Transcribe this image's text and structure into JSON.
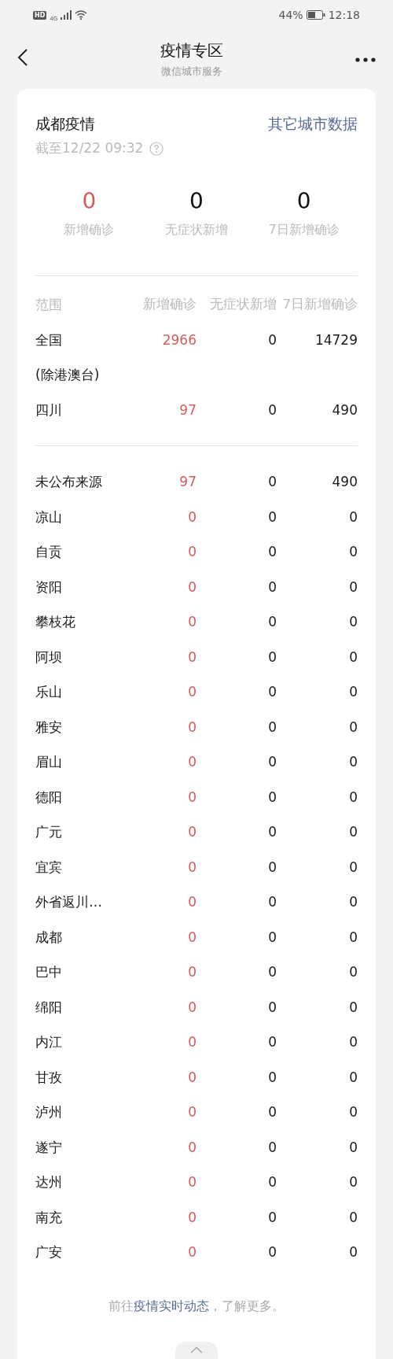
{
  "status_bar": {
    "hd": "HD",
    "network": "4G",
    "battery": "44%",
    "time": "12:18"
  },
  "header": {
    "title": "疫情专区",
    "subtitle": "微信城市服务"
  },
  "card": {
    "city_title": "成都疫情",
    "other_cities_link": "其它城市数据",
    "updated": "截至12/22 09:32",
    "stats": [
      {
        "value": "0",
        "label": "新增确诊",
        "highlight": true
      },
      {
        "value": "0",
        "label": "无症状新增",
        "highlight": false
      },
      {
        "value": "0",
        "label": "7日新增确诊",
        "highlight": false
      }
    ],
    "table": {
      "columns": [
        "范围",
        "新增确诊",
        "无症状新增",
        "7日新增确诊"
      ],
      "groups": [
        [
          {
            "name": "全国(除港澳台)",
            "new_confirmed": "2966",
            "asymptomatic": "0",
            "confirmed_7d": "14729"
          },
          {
            "name": "四川",
            "new_confirmed": "97",
            "asymptomatic": "0",
            "confirmed_7d": "490"
          }
        ],
        [
          {
            "name": "未公布来源",
            "new_confirmed": "97",
            "asymptomatic": "0",
            "confirmed_7d": "490"
          },
          {
            "name": "凉山",
            "new_confirmed": "0",
            "asymptomatic": "0",
            "confirmed_7d": "0"
          },
          {
            "name": "自贡",
            "new_confirmed": "0",
            "asymptomatic": "0",
            "confirmed_7d": "0"
          },
          {
            "name": "资阳",
            "new_confirmed": "0",
            "asymptomatic": "0",
            "confirmed_7d": "0"
          },
          {
            "name": "攀枝花",
            "new_confirmed": "0",
            "asymptomatic": "0",
            "confirmed_7d": "0"
          },
          {
            "name": "阿坝",
            "new_confirmed": "0",
            "asymptomatic": "0",
            "confirmed_7d": "0"
          },
          {
            "name": "乐山",
            "new_confirmed": "0",
            "asymptomatic": "0",
            "confirmed_7d": "0"
          },
          {
            "name": "雅安",
            "new_confirmed": "0",
            "asymptomatic": "0",
            "confirmed_7d": "0"
          },
          {
            "name": "眉山",
            "new_confirmed": "0",
            "asymptomatic": "0",
            "confirmed_7d": "0"
          },
          {
            "name": "德阳",
            "new_confirmed": "0",
            "asymptomatic": "0",
            "confirmed_7d": "0"
          },
          {
            "name": "广元",
            "new_confirmed": "0",
            "asymptomatic": "0",
            "confirmed_7d": "0"
          },
          {
            "name": "宜宾",
            "new_confirmed": "0",
            "asymptomatic": "0",
            "confirmed_7d": "0"
          },
          {
            "name": "外省返川…",
            "new_confirmed": "0",
            "asymptomatic": "0",
            "confirmed_7d": "0"
          },
          {
            "name": "成都",
            "new_confirmed": "0",
            "asymptomatic": "0",
            "confirmed_7d": "0"
          },
          {
            "name": "巴中",
            "new_confirmed": "0",
            "asymptomatic": "0",
            "confirmed_7d": "0"
          },
          {
            "name": "绵阳",
            "new_confirmed": "0",
            "asymptomatic": "0",
            "confirmed_7d": "0"
          },
          {
            "name": "内江",
            "new_confirmed": "0",
            "asymptomatic": "0",
            "confirmed_7d": "0"
          },
          {
            "name": "甘孜",
            "new_confirmed": "0",
            "asymptomatic": "0",
            "confirmed_7d": "0"
          },
          {
            "name": "泸州",
            "new_confirmed": "0",
            "asymptomatic": "0",
            "confirmed_7d": "0"
          },
          {
            "name": "遂宁",
            "new_confirmed": "0",
            "asymptomatic": "0",
            "confirmed_7d": "0"
          },
          {
            "name": "达州",
            "new_confirmed": "0",
            "asymptomatic": "0",
            "confirmed_7d": "0"
          },
          {
            "name": "南充",
            "new_confirmed": "0",
            "asymptomatic": "0",
            "confirmed_7d": "0"
          },
          {
            "name": "广安",
            "new_confirmed": "0",
            "asymptomatic": "0",
            "confirmed_7d": "0"
          }
        ]
      ]
    },
    "footer": {
      "prefix": "前往",
      "link": "疫情实时动态",
      "suffix": "，了解更多。"
    }
  }
}
